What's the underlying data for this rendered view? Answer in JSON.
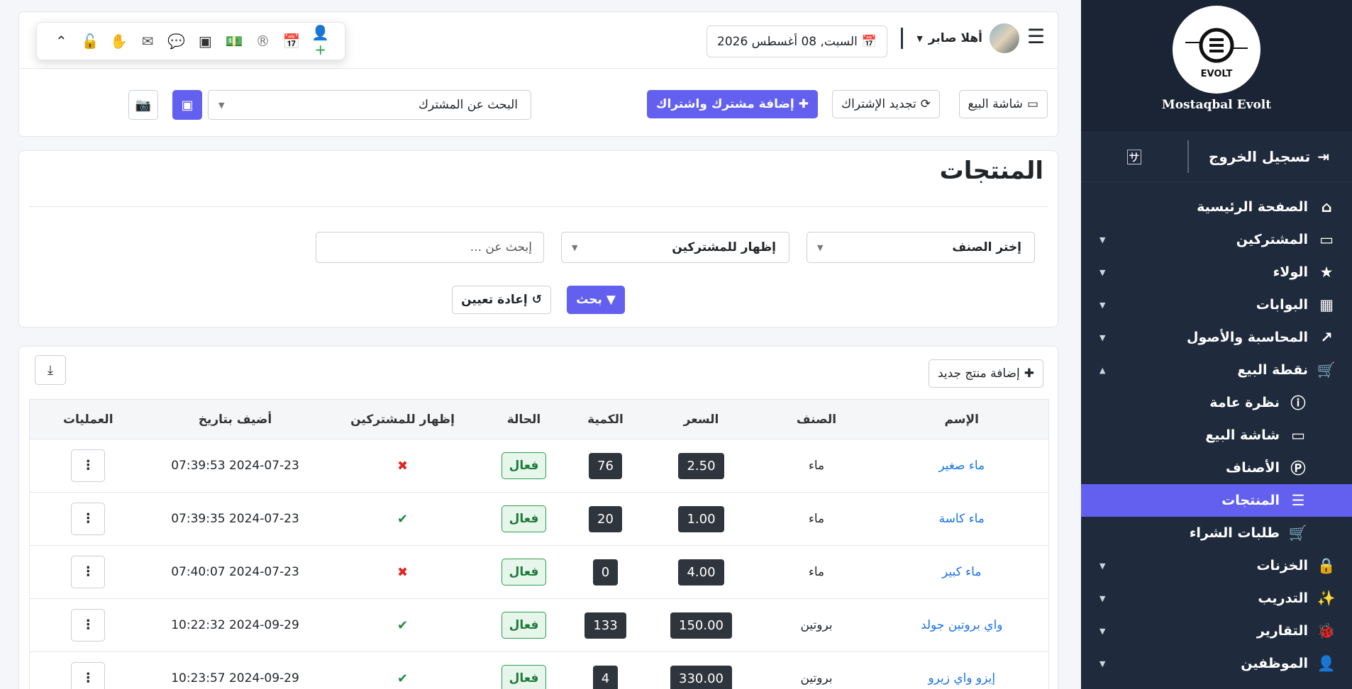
{
  "sidebar": {
    "logo_text": "EVOLT",
    "company": "Mostaqbal Evolt",
    "logout": "تسجيل الخروج",
    "items": [
      {
        "label": "الصفحة الرئيسية",
        "icon": "home-icon",
        "glyph": "🏠"
      },
      {
        "label": "المشتركين",
        "icon": "laptop-icon",
        "glyph": "💻"
      },
      {
        "label": "الولاء",
        "icon": "star-icon",
        "glyph": "★"
      },
      {
        "label": "البوابات",
        "icon": "building-icon",
        "glyph": "▦"
      },
      {
        "label": "المحاسبة والأصول",
        "icon": "chart-icon",
        "glyph": "📈"
      },
      {
        "label": "نقطة البيع",
        "icon": "cart-icon",
        "glyph": "🛒"
      },
      {
        "label": "نظرة عامة",
        "icon": "info-icon",
        "glyph": "ℹ"
      },
      {
        "label": "شاشة البيع",
        "icon": "laptop-icon",
        "glyph": "💻"
      },
      {
        "label": "الأصناف",
        "icon": "p-circle-icon",
        "glyph": "Ⓟ"
      },
      {
        "label": "المنتجات",
        "icon": "list-icon",
        "glyph": "☰"
      },
      {
        "label": "طلبات الشراء",
        "icon": "cart-plus-icon",
        "glyph": "🛒"
      },
      {
        "label": "الخزنات",
        "icon": "lock-icon",
        "glyph": "🔒"
      },
      {
        "label": "التدريب",
        "icon": "wand-icon",
        "glyph": "✨"
      },
      {
        "label": "التقارير",
        "icon": "bug-icon",
        "glyph": "🐞"
      },
      {
        "label": "الموظفين",
        "icon": "user-icon",
        "glyph": "👤"
      }
    ]
  },
  "header": {
    "greeting": "أهلا صابر",
    "date": "السبت, 08 أغسطس 2026"
  },
  "actions": {
    "pos_screen": "شاشة البيع",
    "renew": "تجديد الإشتراك",
    "add_subscriber": "إضافة مشترك واشتراك",
    "search_subscriber": "البحث عن المشترك"
  },
  "filters": {
    "title": "المنتجات",
    "category_placeholder": "إختر الصنف",
    "visibility": "إظهار للمشتركين",
    "search_placeholder": "إبحث عن ...",
    "search_btn": "بحث",
    "reset_btn": "إعادة تعيين"
  },
  "table": {
    "add_product": "إضافة منتج جديد",
    "headers": {
      "name": "الإسم",
      "category": "الصنف",
      "price": "السعر",
      "qty": "الكمية",
      "status": "الحالة",
      "show": "إظهار للمشتركين",
      "added": "أضيف بتاريخ",
      "ops": "العمليات"
    },
    "rows": [
      {
        "name": "ماء صغير",
        "category": "ماء",
        "price": "2.50",
        "qty": "76",
        "status": "فعال",
        "show": "✖",
        "added": "2024-07-23 07:39:53"
      },
      {
        "name": "ماء كاسة",
        "category": "ماء",
        "price": "1.00",
        "qty": "20",
        "status": "فعال",
        "show": "✔",
        "added": "2024-07-23 07:39:35"
      },
      {
        "name": "ماء كبير",
        "category": "ماء",
        "price": "4.00",
        "qty": "0",
        "status": "فعال",
        "show": "✖",
        "added": "2024-07-23 07:40:07"
      },
      {
        "name": "واي بروتين جولد",
        "category": "بروتين",
        "price": "150.00",
        "qty": "133",
        "status": "فعال",
        "show": "✔",
        "added": "2024-09-29 10:22:32"
      },
      {
        "name": "إيزو واي زيرو",
        "category": "بروتين",
        "price": "330.00",
        "qty": "4",
        "status": "فعال",
        "show": "✔",
        "added": "2024-09-29 10:23:57"
      }
    ]
  },
  "colors": {
    "accent": "#6360f0",
    "sidebar": "#1f2a3c",
    "link": "#1a73e8"
  }
}
